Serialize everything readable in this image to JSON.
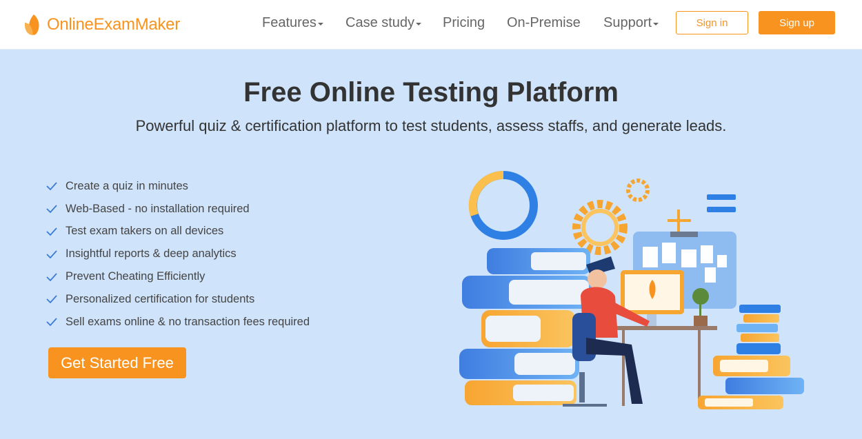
{
  "header": {
    "brand": "OnlineExamMaker",
    "nav": [
      {
        "label": "Features",
        "dropdown": true
      },
      {
        "label": "Case study",
        "dropdown": true
      },
      {
        "label": "Pricing",
        "dropdown": false
      },
      {
        "label": "On-Premise",
        "dropdown": false
      },
      {
        "label": "Support",
        "dropdown": true
      }
    ],
    "sign_in": "Sign in",
    "sign_up": "Sign up"
  },
  "hero": {
    "title": "Free Online Testing Platform",
    "subtitle": "Powerful quiz & certification platform to test students, assess staffs, and generate leads.",
    "features": [
      "Create a quiz in minutes",
      "Web-Based - no installation required",
      "Test exam takers on all devices",
      "Insightful reports & deep analytics",
      "Prevent Cheating Efficiently",
      "Personalized certification for students",
      "Sell exams online & no transaction fees required"
    ],
    "cta": "Get Started Free"
  },
  "colors": {
    "brand_orange": "#f7931e",
    "hero_background": "#cfe3fb",
    "check_blue": "#3a7bd5"
  }
}
